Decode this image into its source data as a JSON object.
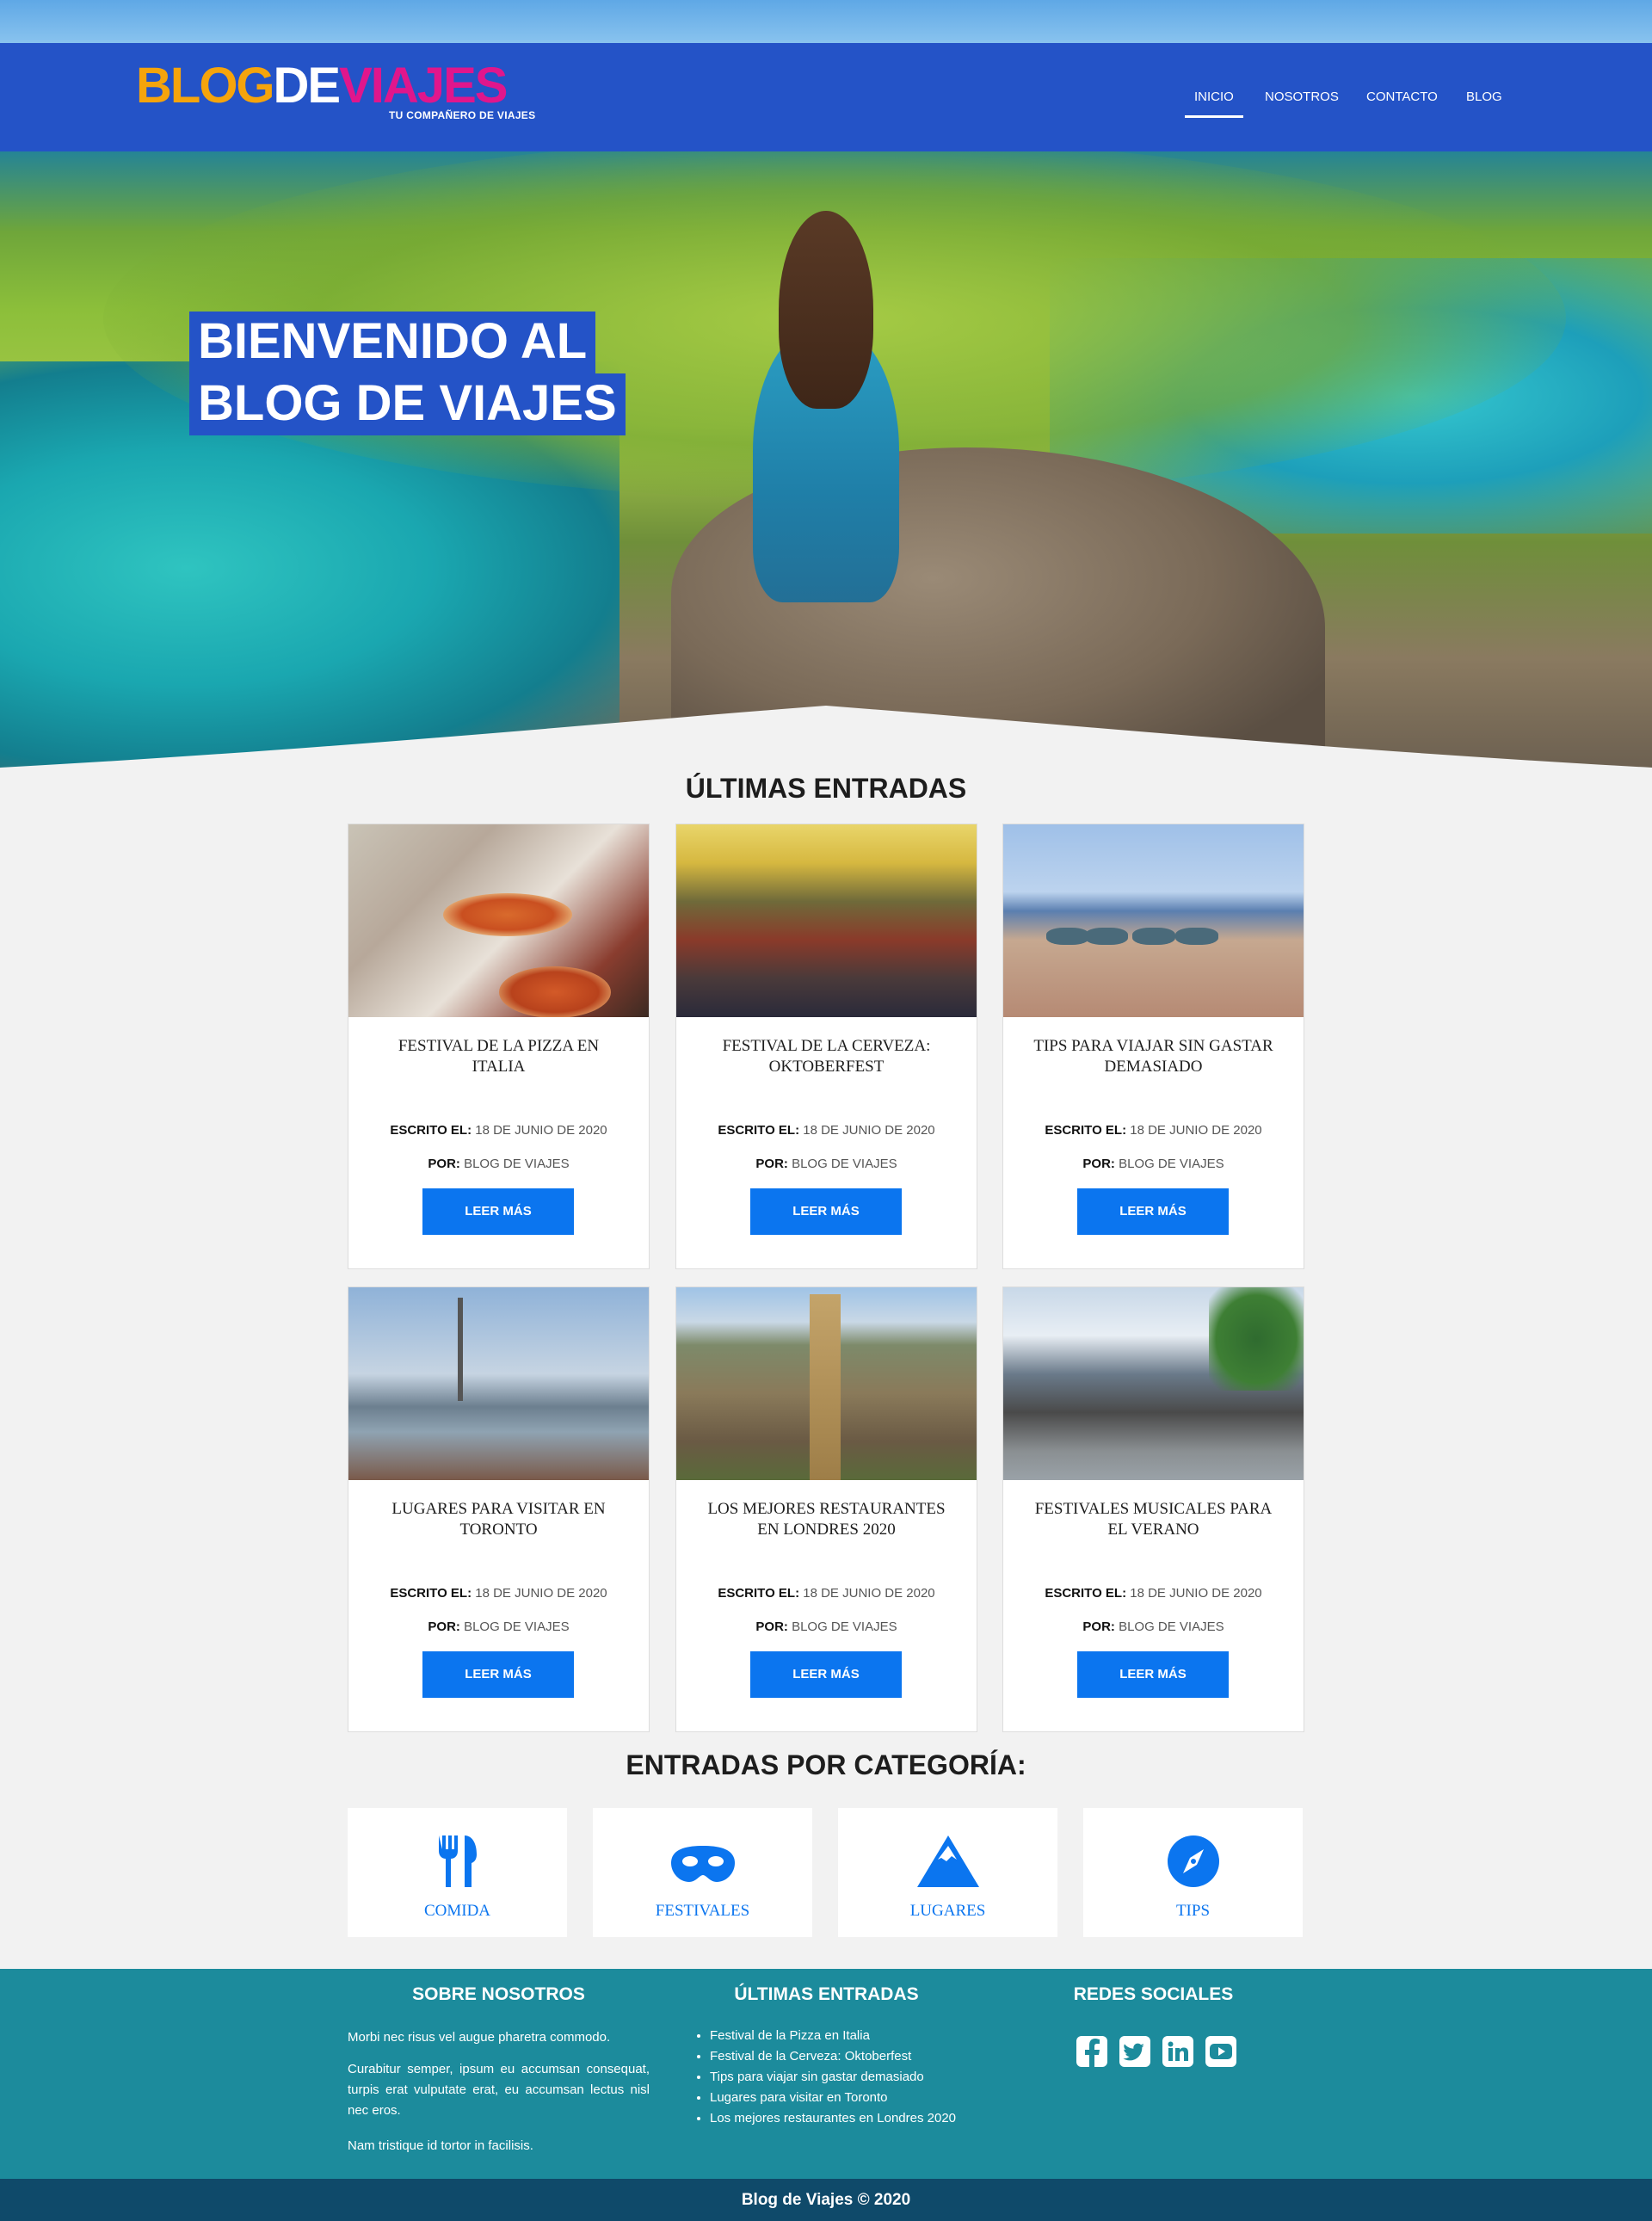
{
  "brand": {
    "logo_part1": "BLOG",
    "logo_part2": "DE",
    "logo_part3": "VIAJES",
    "tagline": "TU COMPAÑERO DE VIAJES",
    "colors": {
      "header": "#2453c7",
      "accent": "#0b75ef",
      "logo_orange": "#f5a40c",
      "logo_pink": "#e0168c",
      "footer": "#1c8b9c",
      "footer_bottom": "#0f4a6a"
    }
  },
  "nav": {
    "items": [
      {
        "label": "INICIO",
        "active": true
      },
      {
        "label": "NOSOTROS",
        "active": false
      },
      {
        "label": "CONTACTO",
        "active": false
      },
      {
        "label": "BLOG",
        "active": false
      }
    ]
  },
  "hero": {
    "line1": "BIENVENIDO AL",
    "line2": "BLOG DE VIAJES"
  },
  "latest": {
    "title": "ÚLTIMAS ENTRADAS",
    "written_label": "ESCRITO EL:",
    "by_label": "POR:",
    "button_label": "LEER MÁS",
    "posts": [
      {
        "title": "FESTIVAL DE LA PIZZA EN ITALIA",
        "date": "18 DE JUNIO DE 2020",
        "author": "BLOG DE VIAJES"
      },
      {
        "title": "FESTIVAL DE LA CERVEZA: OKTOBERFEST",
        "date": "18 DE JUNIO DE 2020",
        "author": "BLOG DE VIAJES"
      },
      {
        "title": "TIPS PARA VIAJAR SIN GASTAR DEMASIADO",
        "date": "18 DE JUNIO DE 2020",
        "author": "BLOG DE VIAJES"
      },
      {
        "title": "LUGARES PARA VISITAR EN TORONTO",
        "date": "18 DE JUNIO DE 2020",
        "author": "BLOG DE VIAJES"
      },
      {
        "title": "LOS MEJORES RESTAURANTES EN LONDRES 2020",
        "date": "18 DE JUNIO DE 2020",
        "author": "BLOG DE VIAJES"
      },
      {
        "title": "FESTIVALES MUSICALES PARA EL VERANO",
        "date": "18 DE JUNIO DE 2020",
        "author": "BLOG DE VIAJES"
      }
    ]
  },
  "categories": {
    "title": "ENTRADAS POR CATEGORÍA:",
    "items": [
      {
        "label": "COMIDA",
        "icon": "utensils-icon"
      },
      {
        "label": "FESTIVALES",
        "icon": "mask-icon"
      },
      {
        "label": "LUGARES",
        "icon": "mountain-icon"
      },
      {
        "label": "TIPS",
        "icon": "compass-icon"
      }
    ]
  },
  "footer": {
    "about_title": "SOBRE NOSOTROS",
    "about_p1": "Morbi nec risus vel augue pharetra commodo.",
    "about_p2": "Curabitur semper, ipsum eu accumsan consequat, turpis erat vulputate erat, eu accumsan lectus nisl nec eros.",
    "about_p3": "Nam tristique id tortor in facilisis.",
    "latest_title": "ÚLTIMAS ENTRADAS",
    "latest_items": [
      "Festival de la Pizza en Italia",
      "Festival de la Cerveza: Oktoberfest",
      "Tips para viajar sin gastar demasiado",
      "Lugares para visitar en Toronto",
      "Los mejores restaurantes en Londres 2020"
    ],
    "social_title": "REDES SOCIALES",
    "social": [
      "facebook-icon",
      "twitter-icon",
      "linkedin-icon",
      "youtube-icon"
    ],
    "copyright": "Blog de Viajes © 2020"
  }
}
